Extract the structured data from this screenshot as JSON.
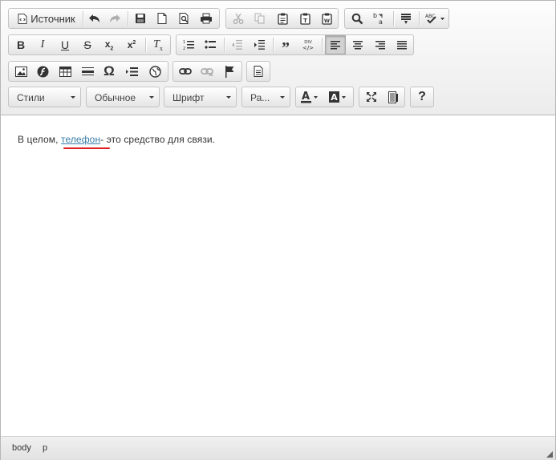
{
  "toolbar": {
    "source_label": "Источник",
    "styles_combo": "Стили",
    "format_combo": "Обычное",
    "font_combo": "Шрифт",
    "size_combo": "Ра..."
  },
  "content": {
    "text_before": "В целом, ",
    "link_text": "телефон",
    "text_after": "- это средство для связи."
  },
  "elementspath": {
    "items": [
      "body",
      "p"
    ]
  },
  "icons": [
    "source-icon",
    "undo-icon",
    "redo-icon",
    "save-icon",
    "new-page-icon",
    "preview-icon",
    "print-icon",
    "cut-icon",
    "copy-icon",
    "paste-icon",
    "paste-text-icon",
    "paste-word-icon",
    "find-icon",
    "replace-icon",
    "select-all-icon",
    "spellcheck-icon",
    "bold-icon",
    "italic-icon",
    "underline-icon",
    "strike-icon",
    "subscript-icon",
    "superscript-icon",
    "remove-format-icon",
    "numbered-list-icon",
    "bulleted-list-icon",
    "outdent-icon",
    "indent-icon",
    "blockquote-icon",
    "div-icon",
    "align-left-icon",
    "align-center-icon",
    "align-right-icon",
    "justify-icon",
    "image-icon",
    "flash-icon",
    "table-icon",
    "horizontal-rule-icon",
    "special-char-icon",
    "page-break-icon",
    "iframe-icon",
    "link-icon",
    "unlink-icon",
    "anchor-icon",
    "templates-icon",
    "text-color-icon",
    "bg-color-icon",
    "maximize-icon",
    "show-blocks-icon",
    "about-icon"
  ]
}
